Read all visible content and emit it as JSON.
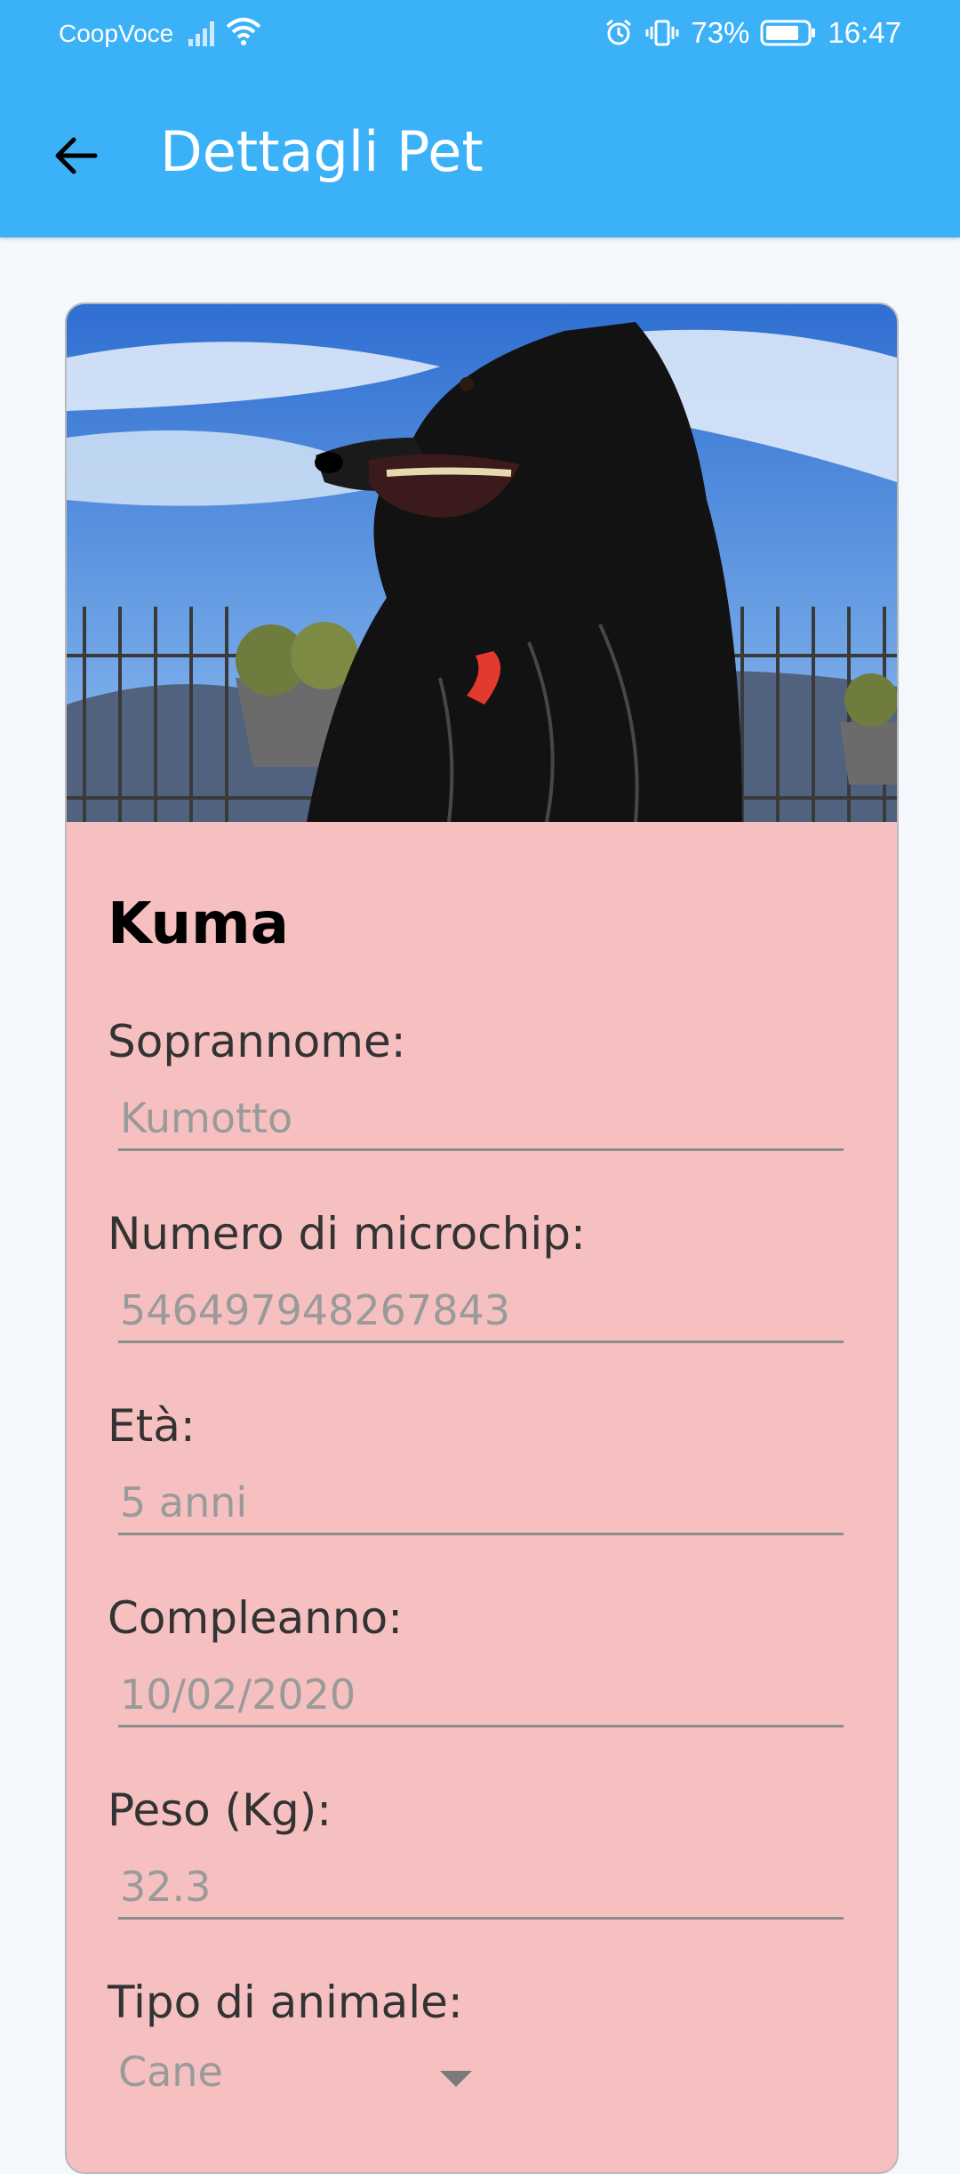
{
  "status_bar": {
    "carrier": "CoopVoce",
    "battery": "73%",
    "time": "16:47",
    "icons": [
      "signal-icon",
      "wifi-icon",
      "alarm-icon",
      "vibrate-icon",
      "battery-icon"
    ]
  },
  "app_bar": {
    "title": "Dettagli Pet",
    "back_icon": "arrow-left-icon"
  },
  "pet": {
    "name": "Kuma",
    "photo": "dog-photo",
    "fields": [
      {
        "label": "Soprannome:",
        "value": "Kumotto"
      },
      {
        "label": "Numero di microchip:",
        "value": "546497948267843"
      },
      {
        "label": "Età:",
        "value": "5 anni"
      },
      {
        "label": "Compleanno:",
        "value": "10/02/2020"
      },
      {
        "label": "Peso (Kg):",
        "value": "32.3"
      },
      {
        "label": "Tipo di animale:",
        "value": "Cane"
      }
    ]
  },
  "colors": {
    "primary": "#3bb1f8",
    "card_background": "#f6c0c1",
    "page_background": "#f4f8fd"
  }
}
